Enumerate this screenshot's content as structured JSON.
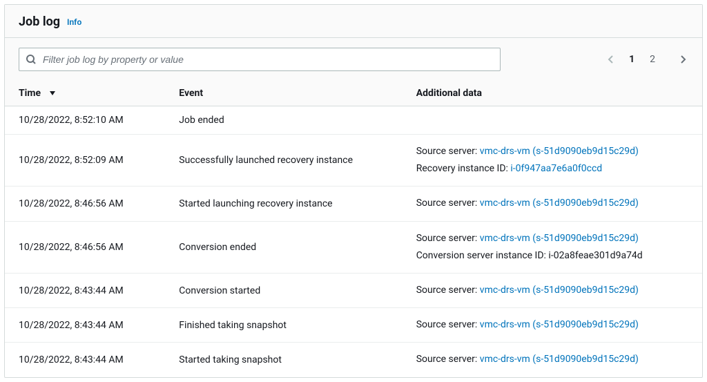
{
  "header": {
    "title": "Job log",
    "info_label": "Info"
  },
  "search": {
    "placeholder": "Filter job log by property or value"
  },
  "pagination": {
    "pages": [
      "1",
      "2"
    ],
    "current": "1"
  },
  "columns": {
    "time": "Time",
    "event": "Event",
    "additional": "Additional data"
  },
  "rows": [
    {
      "time": "10/28/2022, 8:52:10 AM",
      "event": "Job ended",
      "additional": []
    },
    {
      "time": "10/28/2022, 8:52:09 AM",
      "event": "Successfully launched recovery instance",
      "additional": [
        {
          "label": "Source server:",
          "value": "vmc-drs-vm (s-51d9090eb9d15c29d)",
          "value_is_link": true
        },
        {
          "label": "Recovery instance ID:",
          "value": "i-0f947aa7e6a0f0ccd",
          "value_is_link": true
        }
      ]
    },
    {
      "time": "10/28/2022, 8:46:56 AM",
      "event": "Started launching recovery instance",
      "additional": [
        {
          "label": "Source server:",
          "value": "vmc-drs-vm (s-51d9090eb9d15c29d)",
          "value_is_link": true
        }
      ]
    },
    {
      "time": "10/28/2022, 8:46:56 AM",
      "event": "Conversion ended",
      "additional": [
        {
          "label": "Source server:",
          "value": "vmc-drs-vm (s-51d9090eb9d15c29d)",
          "value_is_link": true
        },
        {
          "label": "Conversion server instance ID:",
          "value": "i-02a8feae301d9a74d",
          "value_is_link": false
        }
      ]
    },
    {
      "time": "10/28/2022, 8:43:44 AM",
      "event": "Conversion started",
      "additional": [
        {
          "label": "Source server:",
          "value": "vmc-drs-vm (s-51d9090eb9d15c29d)",
          "value_is_link": true
        }
      ]
    },
    {
      "time": "10/28/2022, 8:43:44 AM",
      "event": "Finished taking snapshot",
      "additional": [
        {
          "label": "Source server:",
          "value": "vmc-drs-vm (s-51d9090eb9d15c29d)",
          "value_is_link": true
        }
      ]
    },
    {
      "time": "10/28/2022, 8:43:44 AM",
      "event": "Started taking snapshot",
      "additional": [
        {
          "label": "Source server:",
          "value": "vmc-drs-vm (s-51d9090eb9d15c29d)",
          "value_is_link": true
        }
      ]
    }
  ]
}
